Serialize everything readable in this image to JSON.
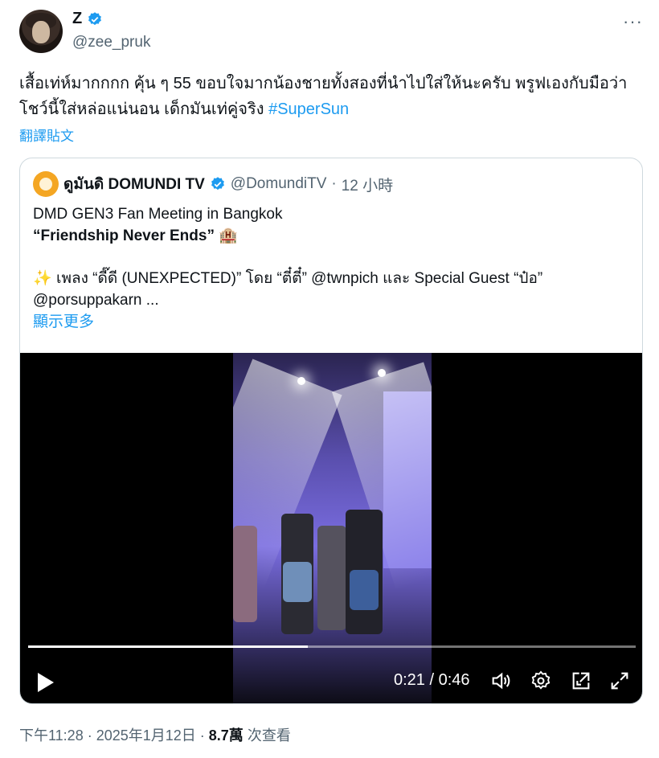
{
  "header": {
    "name": "Z",
    "handle": "@zee_pruk",
    "more": "···"
  },
  "tweet": {
    "text": "เสื้อเท่ห์มากกกก คุ้น ๆ 55 ขอบใจมากน้องชายทั้งสองที่นำไปใส่ให้นะครับ พรูฟเองกับมือว่าโชว์นี้ใส่หล่อแน่นอน เด็กมันเท่คู่จริง",
    "hashtag": "#SuperSun",
    "translate": "翻譯貼文"
  },
  "quote": {
    "name": "ดูมันดิ DOMUNDI TV",
    "handle": "@DomundiTV",
    "dot": "·",
    "time": "12 小時",
    "line1": "DMD GEN3 Fan Meeting in Bangkok",
    "line2": "“Friendship Never Ends”",
    "line2_emoji": "🏨",
    "line3_sparkle": "✨",
    "line3_a": "เพลง “",
    "line3_song": "ดี๊ดี",
    "line3_b": " (UNEXPECTED)” โดย “",
    "line3_artist": "ตี๋ตี๋",
    "line3_c": "” @twnpich  และ Special Guest “ป๋อ”",
    "line4": "@porsuppakarn ...",
    "show_more": "顯示更多"
  },
  "video": {
    "time": "0:21 / 0:46",
    "progress": 0.46
  },
  "footer": {
    "time": "下午11:28 · 2025年1月12日 · ",
    "views_count": "8.7萬",
    "views_label": " 次查看"
  },
  "colors": {
    "accent": "#1d9bf0",
    "muted": "#536471",
    "border": "#cfd9de"
  },
  "icons": [
    "verified-badge-icon",
    "more-options-icon",
    "play-icon",
    "volume-icon",
    "settings-icon",
    "pop-out-icon",
    "fullscreen-icon"
  ]
}
